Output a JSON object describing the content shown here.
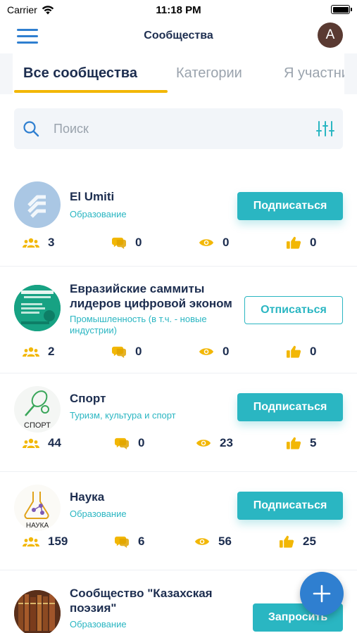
{
  "status_bar": {
    "carrier": "Carrier",
    "time": "11:18 PM"
  },
  "header": {
    "title": "Сообщества",
    "avatar_initial": "A"
  },
  "tabs": [
    {
      "label": "Все сообщества",
      "active": true
    },
    {
      "label": "Категории",
      "active": false
    },
    {
      "label": "Я участник",
      "active": false
    }
  ],
  "search": {
    "placeholder": "Поиск",
    "value": ""
  },
  "communities": [
    {
      "name": "El Umiti",
      "category": "Образование",
      "action": "Подписаться",
      "members": "3",
      "comments": "0",
      "views": "0",
      "likes": "0"
    },
    {
      "name": "Евразийские саммиты лидеров цифровой эконом",
      "category": "Промышленность (в т.ч. - новые индустрии)",
      "action": "Отписаться",
      "members": "2",
      "comments": "0",
      "views": "0",
      "likes": "0"
    },
    {
      "name": "Спорт",
      "category": "Туризм, культура и спорт",
      "action": "Подписаться",
      "thumb_label": "СПОРТ",
      "members": "44",
      "comments": "0",
      "views": "23",
      "likes": "5"
    },
    {
      "name": "Наука",
      "category": "Образование",
      "action": "Подписаться",
      "thumb_label": "НАУКА",
      "members": "159",
      "comments": "6",
      "views": "56",
      "likes": "25"
    },
    {
      "name": "Сообщество \"Казахская поэзия\"",
      "category": "Образование",
      "action": "Запросить"
    }
  ],
  "colors": {
    "accent": "#2ab6c2",
    "tab_underline": "#f2b705",
    "fab": "#2f7fd0",
    "stat_icon": "#f2b705",
    "text_dark": "#1c2d4f"
  }
}
